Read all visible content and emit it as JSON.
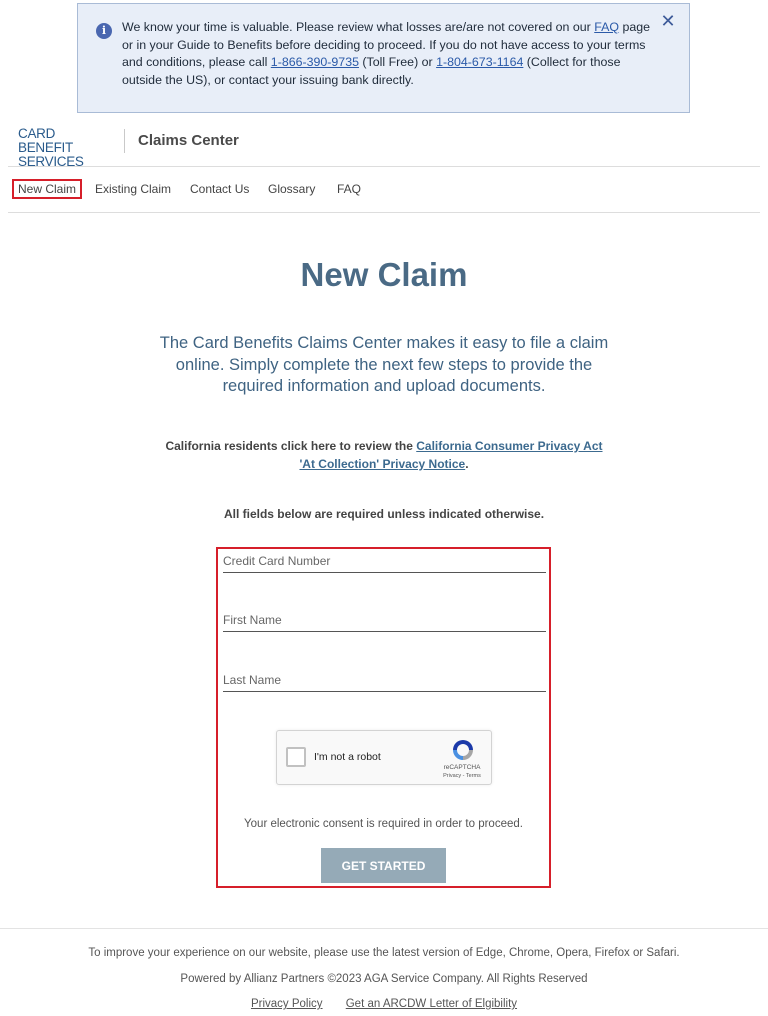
{
  "notice": {
    "text_1": "We know your time is valuable. Please review what losses are/are not covered on our ",
    "faq_link": "FAQ",
    "text_2": " page or in your Guide to Benefits before deciding to proceed. If you do not have access to your terms and conditions, please call ",
    "toll_free_phone": "1-866-390-9735",
    "text_3": " (Toll Free) or ",
    "collect_phone": "1-804-673-1164",
    "text_4": " (Collect for those outside the US), or contact your issuing bank directly.",
    "close_icon": "close-icon",
    "info_icon": "info-icon"
  },
  "header": {
    "logo_line1": "CARD BENEFIT",
    "logo_line2": "SERVICES",
    "title": "Claims Center"
  },
  "nav": {
    "items": [
      {
        "label": "New Claim",
        "active": true
      },
      {
        "label": "Existing Claim",
        "active": false
      },
      {
        "label": "Contact Us",
        "active": false
      },
      {
        "label": "Glossary",
        "active": false
      },
      {
        "label": "FAQ",
        "active": false
      }
    ]
  },
  "main": {
    "title": "New Claim",
    "intro": "The Card Benefits Claims Center makes it easy to file a claim online. Simply complete the next few steps to provide the required information and upload documents.",
    "ccpa_prefix": "California residents click here to review the ",
    "ccpa_link": "California Consumer Privacy Act 'At Collection' Privacy Notice",
    "ccpa_suffix": ".",
    "required_note": "All fields below are required unless indicated otherwise."
  },
  "form": {
    "card_number_placeholder": "Credit Card Number",
    "first_name_placeholder": "First Name",
    "last_name_placeholder": "Last Name",
    "recaptcha": {
      "label": "I'm not a robot",
      "brand": "reCAPTCHA",
      "links": "Privacy - Terms"
    },
    "consent_text": "Your electronic consent is required in order to proceed.",
    "submit_label": "GET STARTED"
  },
  "footer": {
    "browser_note": "To improve your experience on our website, please use the latest version of Edge, Chrome, Opera, Firefox or Safari.",
    "copyright": "Powered by Allianz Partners ©2023 AGA Service Company. All Rights Reserved",
    "privacy_link": "Privacy Policy",
    "letter_link": "Get an ARCDW Letter of Elgibility"
  },
  "colors": {
    "accent_red": "#d61f2a",
    "title_blue": "#4a6a85",
    "button_gray_blue": "#95aab7",
    "notice_bg": "#e8eef8"
  }
}
